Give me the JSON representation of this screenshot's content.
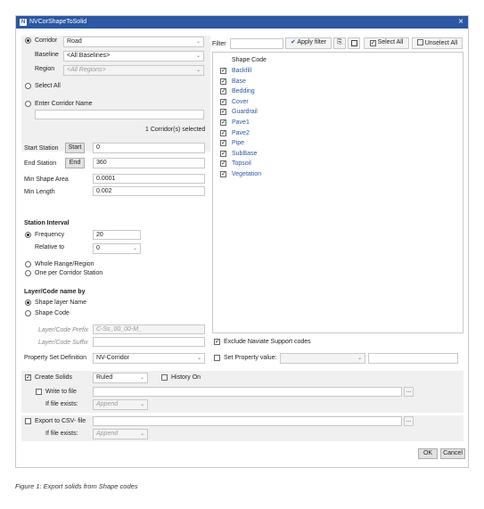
{
  "window": {
    "title": "NVCorShapeToSolid",
    "logo": "N",
    "close": "×"
  },
  "corridor": {
    "radio_label": "Corridor",
    "value": "Road"
  },
  "baseline": {
    "label": "Baseline",
    "value": "<All Baselines>"
  },
  "region": {
    "label": "Region",
    "value": "<All Regions>"
  },
  "select_all_radio": "Select All",
  "enter_corridor_name": {
    "label": "Enter Corridor Name",
    "value": ""
  },
  "corridors_selected": "1 Corridor(s) selected",
  "start_station": {
    "label": "Start Station",
    "button": "Start",
    "value": "0"
  },
  "end_station": {
    "label": "End Station",
    "button": "End",
    "value": "360"
  },
  "min_shape_area": {
    "label": "Min Shape Area",
    "value": "0.0001"
  },
  "min_length": {
    "label": "Min Length",
    "value": "0.002"
  },
  "station_interval": {
    "heading": "Station Interval",
    "frequency_label": "Frequency",
    "frequency_value": "20",
    "relative_label": "Relative to",
    "relative_value": "0",
    "whole_range": "Whole Range/Region",
    "one_per_station": "One per Corridor Station"
  },
  "layer_code": {
    "heading": "Layer/Code name by",
    "shape_layer_name": "Shape layer Name",
    "shape_code": "Shape Code",
    "prefix_label": "Layer/Code Prefix",
    "prefix_value": "C-Ss_00_00-M_",
    "suffix_label": "Layer/Code Suffix",
    "suffix_value": ""
  },
  "filter": {
    "label": "Filter",
    "value": "",
    "apply_button": "Apply filter",
    "select_all_button": "Select All",
    "unselect_all_button": "Unselect All"
  },
  "shape_list": {
    "header": "Shape Code",
    "items": [
      "Backfill",
      "Base",
      "Bedding",
      "Cover",
      "Guardrail",
      "Pave1",
      "Pave2",
      "Pipe",
      "SubBase",
      "Topsoil",
      "Vegetation"
    ]
  },
  "exclude_support_codes": "Exclude Naviate Support codes",
  "property_set": {
    "label": "Property Set Definition",
    "value": "NV-Corridor",
    "set_value_label": "Set Property value:",
    "set_value_value": ""
  },
  "create_solids": {
    "label": "Create Solids",
    "mode": "Ruled",
    "history_label": "History On",
    "write_to_file": "Write to file",
    "file_path": "",
    "browse": "...",
    "if_exists_label": "If file exists:",
    "if_exists_value": "Append"
  },
  "export_csv": {
    "label": "Export to CSV- file",
    "file_path": "",
    "browse": "...",
    "if_exists_label": "If file exists:",
    "if_exists_value": "Append"
  },
  "buttons": {
    "ok": "OK",
    "cancel": "Cancel"
  },
  "caption": "Figure 1: Export solids from Shape codes",
  "colors": {
    "titlebar": "#2b57a3",
    "panel": "#f0f0f0",
    "link_text": "#2b57a3"
  },
  "icons": {
    "apply": "checkmark-icon",
    "save": "save-icon",
    "print": "print-icon"
  }
}
